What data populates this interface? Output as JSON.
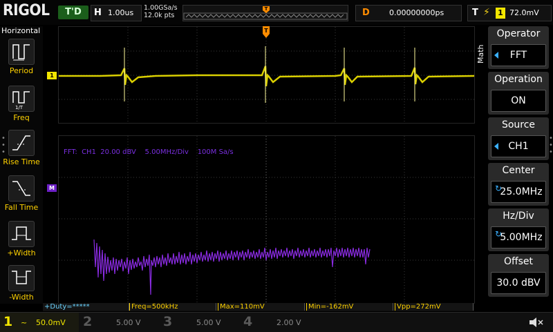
{
  "brand": "RIGOL",
  "run_status": "T'D",
  "horizontal": {
    "label": "H",
    "timebase": "1.00us",
    "sample_rate": "1.00GSa/s",
    "points": "12.0k pts"
  },
  "trigger_position_marker": "T",
  "delay": {
    "label": "D",
    "value": "0.00000000ps"
  },
  "trigger": {
    "label": "T",
    "slope_icon": "rising-edge-icon",
    "source": "1",
    "level": "72.0mV"
  },
  "left_menu": {
    "title": "Horizontal",
    "items": [
      {
        "label": "Period",
        "icon": "period-icon"
      },
      {
        "label": "Freq",
        "icon": "frequency-icon"
      },
      {
        "label": "Rise Time",
        "icon": "rise-time-icon"
      },
      {
        "label": "Fall Time",
        "icon": "fall-time-icon"
      },
      {
        "label": "+Width",
        "icon": "positive-width-icon"
      },
      {
        "label": "-Width",
        "icon": "negative-width-icon"
      }
    ]
  },
  "right_menu": {
    "tab": "Math",
    "items": [
      {
        "title": "Operator",
        "value": "FFT"
      },
      {
        "title": "Operation",
        "value": "ON"
      },
      {
        "title": "Source",
        "value": "CH1"
      },
      {
        "title": "Center",
        "value": "25.0MHz"
      },
      {
        "title": "Hz/Div",
        "value": "5.00MHz"
      },
      {
        "title": "Offset",
        "value": "30.0 dBV"
      }
    ]
  },
  "fft_info": "FFT:  CH1  20.00 dBV    5.00MHz/Div    100M Sa/s",
  "channel_marker": "1",
  "math_marker": "M",
  "measurements": [
    "+Duty=*****",
    "Freq=500kHz",
    "Max=110mV",
    "Min=-162mV",
    "Vpp=272mV"
  ],
  "channels": [
    {
      "num": "1",
      "coupling": "~",
      "scale": "50.0mV",
      "color": "#f2e600"
    },
    {
      "num": "2",
      "coupling": "",
      "scale": "5.00 V",
      "color": "#00a8e8"
    },
    {
      "num": "3",
      "coupling": "",
      "scale": "5.00 V",
      "color": "#d050d0"
    },
    {
      "num": "4",
      "coupling": "",
      "scale": "2.00 V",
      "color": "#1e6cff"
    }
  ],
  "colors": {
    "ch1_trace": "#f2e600",
    "math_trace": "#8a2be2",
    "accent": "#ff8c00",
    "menu_label": "#ffd200"
  }
}
